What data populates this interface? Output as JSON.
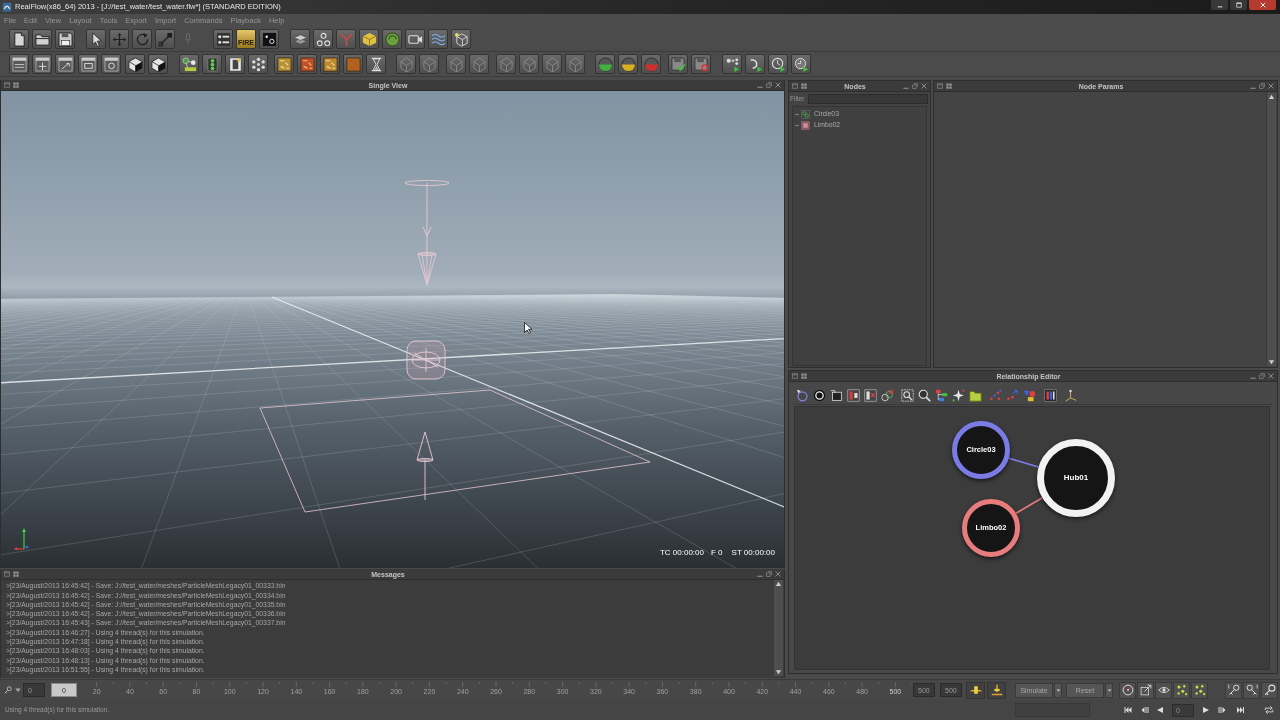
{
  "window": {
    "title": "RealFlow(x86_64) 2013 - [J://test_water/test_water.flw*] (STANDARD EDITION)"
  },
  "menu": [
    "File",
    "Edit",
    "View",
    "Layout",
    "Tools",
    "Export",
    "Import",
    "Commands",
    "Playback",
    "Help"
  ],
  "toolbar": {
    "fire_label": "FIRE"
  },
  "viewport": {
    "title": "Single View",
    "timecode": "TC 00:00:00",
    "frame": "F 0",
    "sim_time": "ST 00:00:00"
  },
  "messages": {
    "title": "Messages",
    "lines": [
      ">[23/August/2013 16:45:42] - Save: J://test_water/meshes/ParticleMeshLegacy01_00333.bin",
      ">[23/August/2013 16:45:42] - Save: J://test_water/meshes/ParticleMeshLegacy01_00334.bin",
      ">[23/August/2013 16:45:42] - Save: J://test_water/meshes/ParticleMeshLegacy01_00335.bin",
      ">[23/August/2013 16:45:42] - Save: J://test_water/meshes/ParticleMeshLegacy01_00336.bin",
      ">[23/August/2013 16:45:43] - Save: J://test_water/meshes/ParticleMeshLegacy01_00337.bin",
      ">[23/August/2013 16:46:27] - Using 4 thread(s) for this simulation.",
      ">[23/August/2013 16:47:18] - Using 4 thread(s) for this simulation.",
      ">[23/August/2013 16:48:03] - Using 4 thread(s) for this simulation.",
      ">[23/August/2013 16:48:13] - Using 4 thread(s) for this simulation.",
      ">[23/August/2013 16:51:55] - Using 4 thread(s) for this simulation."
    ]
  },
  "nodes_panel": {
    "title": "Nodes",
    "filter_label": "Filter",
    "items": [
      {
        "label": "Circle03",
        "kind": "circle",
        "selected": false
      },
      {
        "label": "Limbo02",
        "kind": "limbo",
        "selected": false
      }
    ]
  },
  "node_params": {
    "title": "Node Params"
  },
  "relationship_editor": {
    "title": "Relationship Editor",
    "nodes": [
      {
        "label": "Hub01",
        "kind": "hub",
        "color": "#f2f2f2",
        "children": [
          {
            "label": "Circle03",
            "kind": "emitter",
            "color": "#7b7be6"
          },
          {
            "label": "Limbo02",
            "kind": "emitter",
            "color": "#e67c7c"
          }
        ]
      }
    ]
  },
  "timeline": {
    "start_field": "0",
    "frame_field": "0",
    "ticks": [
      "20",
      "40",
      "60",
      "80",
      "100",
      "120",
      "140",
      "160",
      "180",
      "200",
      "220",
      "240",
      "260",
      "280",
      "300",
      "320",
      "340",
      "360",
      "380",
      "400",
      "420",
      "440",
      "460",
      "480"
    ],
    "end_tick": "500",
    "end_field": "500",
    "max_field": "500"
  },
  "sim_controls": {
    "simulate": "Simulate",
    "reset": "Reset"
  },
  "playback": {
    "frame_field": "0"
  },
  "status_bar": {
    "text": "Using 4 thread(s) for this simulation."
  }
}
